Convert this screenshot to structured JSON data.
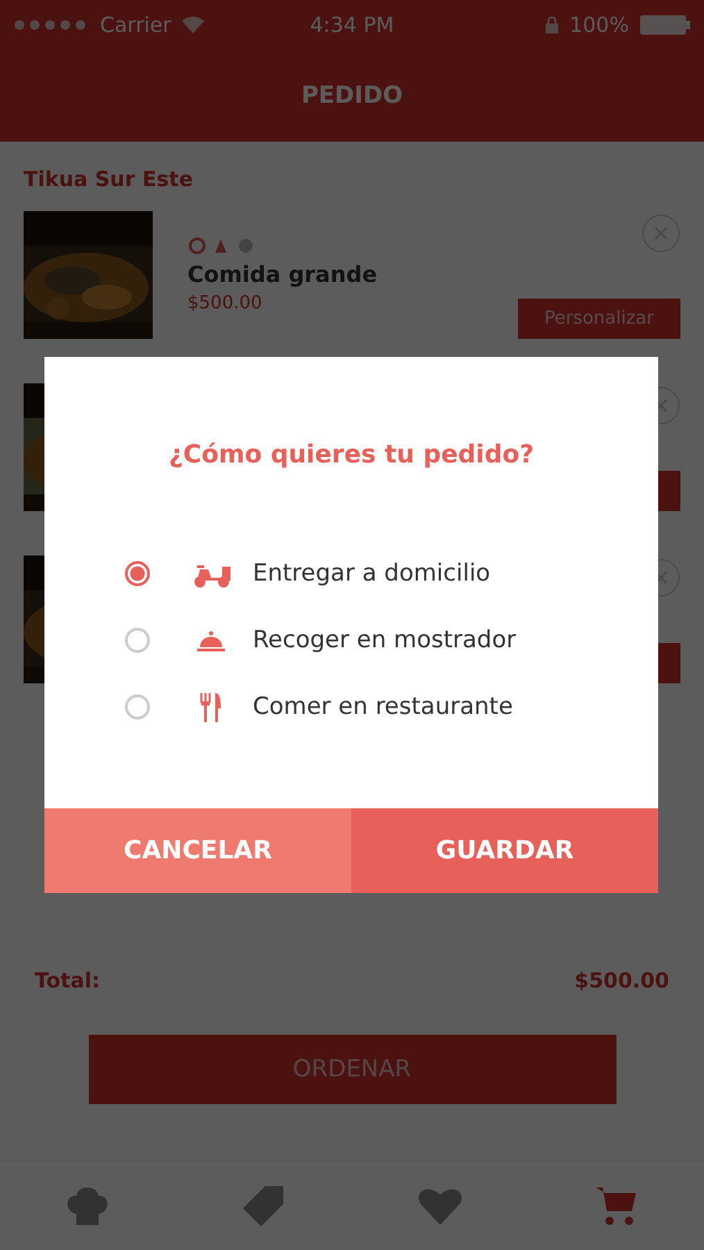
{
  "status_bar": {
    "carrier": "Carrier",
    "time": "4:34 PM",
    "battery": "100%"
  },
  "header": {
    "title": "PEDIDO"
  },
  "section": {
    "title": "Tikua Sur Este"
  },
  "items": [
    {
      "kind": "picture",
      "name": "Comida grande",
      "price": "$500.00",
      "button": "Personalizar"
    },
    {
      "kind": "picture"
    },
    {
      "kind": "picture"
    }
  ],
  "total": {
    "label": "Total:",
    "value": "$500.00"
  },
  "order_button": "ORDENAR",
  "tabs": [
    {
      "kind": "chef",
      "selected": false
    },
    {
      "kind": "tag",
      "selected": false
    },
    {
      "kind": "heart",
      "selected": false
    },
    {
      "kind": "cart",
      "selected": true
    }
  ],
  "dialog": {
    "title": "¿Cómo quieres tu pedido?",
    "options": [
      {
        "kind": "scooter",
        "label": "Entregar a domicilio",
        "selected": true
      },
      {
        "kind": "cloche",
        "label": "Recoger en mostrador",
        "selected": false
      },
      {
        "kind": "cutlery",
        "label": "Comer en restaurante",
        "selected": false
      }
    ],
    "buttons": [
      {
        "kind": "cancel",
        "label": "CANCELAR"
      },
      {
        "kind": "save",
        "label": "GUARDAR"
      }
    ]
  }
}
